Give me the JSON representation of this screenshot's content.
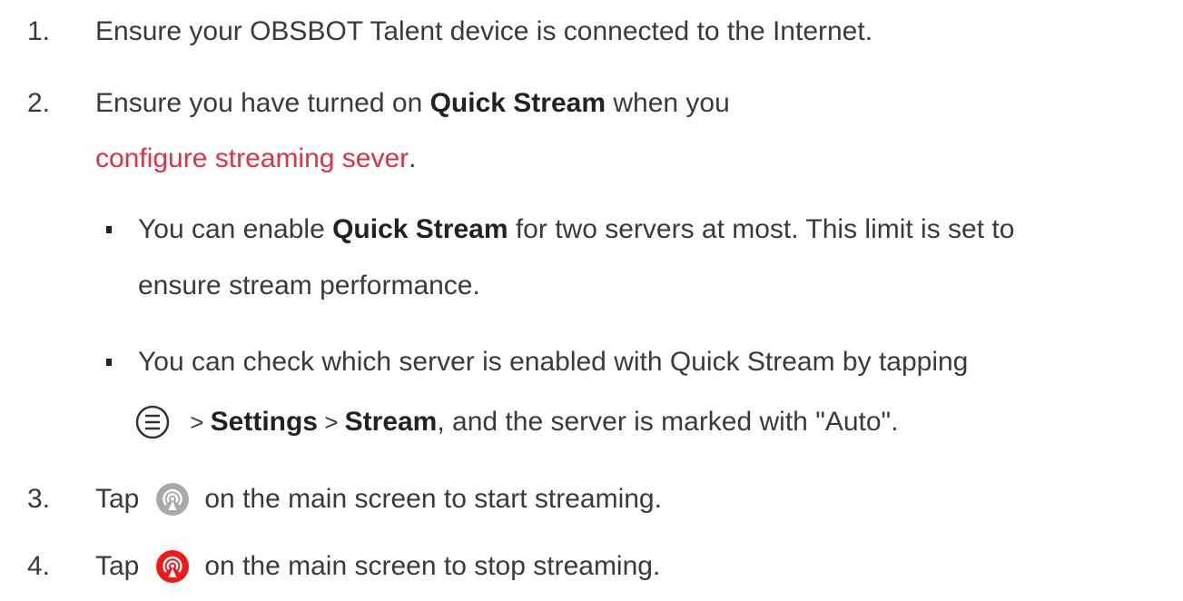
{
  "steps": [
    {
      "number": "1.",
      "text": "Ensure your OBSBOT Talent device is connected to the Internet."
    },
    {
      "number": "2.",
      "pre": "Ensure you have turned on ",
      "bold": "Quick Stream",
      "post": " when you",
      "link": "configure streaming sever",
      "after_link": ".",
      "notes": [
        {
          "pre": "You can enable ",
          "bold": "Quick Stream",
          "post": " for two servers at most. This limit is set to",
          "line2": "ensure stream performance."
        },
        {
          "line1": "You can check which server is enabled with Quick Stream by tapping",
          "menu_icon": "hamburger-menu-icon",
          "sep1": " > ",
          "settings": "Settings",
          "sep2": " > ",
          "stream": "Stream",
          "post": ", and the server is marked with \"Auto\"."
        }
      ]
    },
    {
      "number": "3.",
      "pre": "Tap",
      "icon": "stream-start-icon",
      "icon_color": "#a9a9a9",
      "post": "on the main screen to start streaming."
    },
    {
      "number": "4.",
      "pre": "Tap",
      "icon": "stream-stop-icon",
      "icon_color": "#f21818",
      "post": "on the main screen to stop streaming."
    }
  ],
  "colors": {
    "text": "#3a3a3a",
    "link": "#e0304a"
  }
}
